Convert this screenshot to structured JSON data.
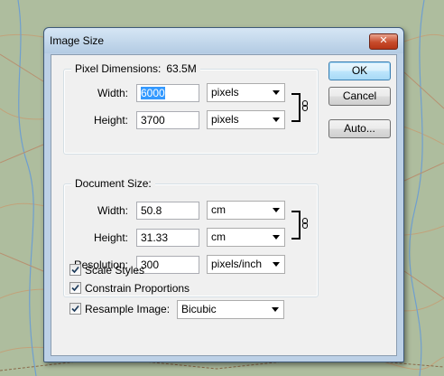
{
  "dialog": {
    "title": "Image Size",
    "close_label": "✕"
  },
  "pixel_dimensions": {
    "label": "Pixel Dimensions:",
    "size": "63.5M",
    "width_label": "Width:",
    "width_value": "6000",
    "width_unit": "pixels",
    "height_label": "Height:",
    "height_value": "3700",
    "height_unit": "pixels",
    "linked": true
  },
  "document_size": {
    "label": "Document Size:",
    "width_label": "Width:",
    "width_value": "50.8",
    "width_unit": "cm",
    "height_label": "Height:",
    "height_value": "31.33",
    "height_unit": "cm",
    "resolution_label": "Resolution:",
    "resolution_value": "300",
    "resolution_unit": "pixels/inch",
    "linked": true
  },
  "buttons": {
    "ok": "OK",
    "cancel": "Cancel",
    "auto": "Auto..."
  },
  "options": {
    "scale_styles": {
      "label": "Scale Styles",
      "checked": true
    },
    "constrain_proportions": {
      "label": "Constrain Proportions",
      "checked": true
    },
    "resample_image": {
      "label": "Resample Image:",
      "checked": true,
      "method": "Bicubic"
    }
  },
  "colors": {
    "dialog_frame": "#bcd0e6",
    "client_bg": "#f0f0f0",
    "selection": "#3399ff",
    "close_button": "#c74b2b",
    "map_bg": "#a9b89a"
  }
}
